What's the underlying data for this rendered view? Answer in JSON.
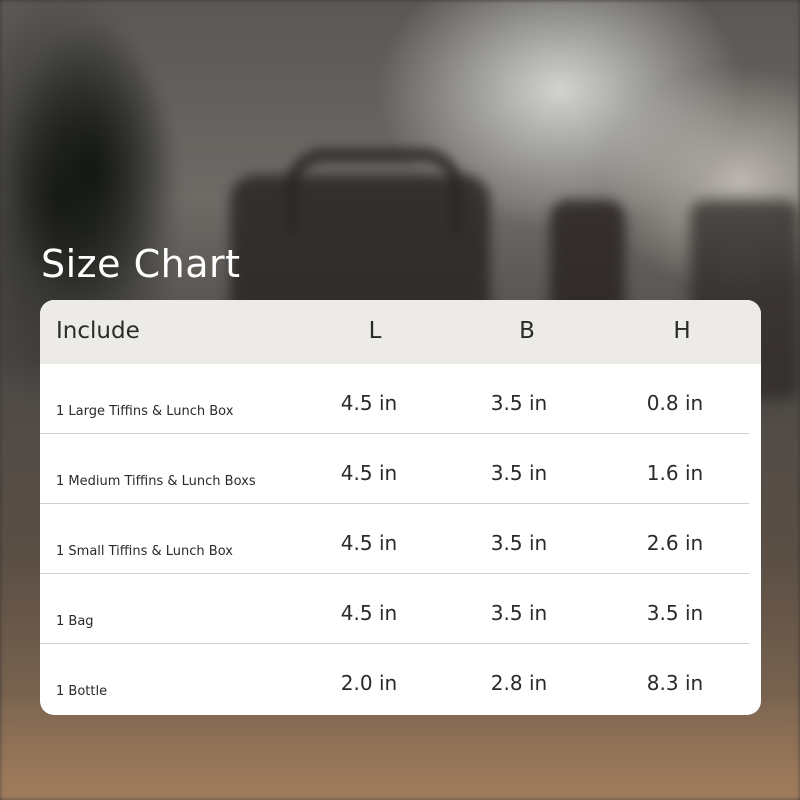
{
  "title": "Size Chart",
  "table": {
    "headers": {
      "include": "Include",
      "l": "L",
      "b": "B",
      "h": "H"
    },
    "rows": [
      {
        "name": "1 Large Tiffins & Lunch Box",
        "l": "4.5 in",
        "b": "3.5 in",
        "h": "0.8 in"
      },
      {
        "name": "1 Medium Tiffins & Lunch Boxs",
        "l": "4.5 in",
        "b": "3.5 in",
        "h": "1.6 in"
      },
      {
        "name": "1 Small Tiffins & Lunch Box",
        "l": "4.5 in",
        "b": "3.5 in",
        "h": "2.6 in"
      },
      {
        "name": "1 Bag",
        "l": "4.5 in",
        "b": "3.5 in",
        "h": "3.5 in"
      },
      {
        "name": "1 Bottle",
        "l": "2.0 in",
        "b": "2.8 in",
        "h": "8.3 in"
      }
    ]
  },
  "colors": {
    "header_bg": "#ecebe7",
    "card_bg": "#ffffff",
    "text": "#2a2a2a",
    "title_text": "#ffffff"
  }
}
